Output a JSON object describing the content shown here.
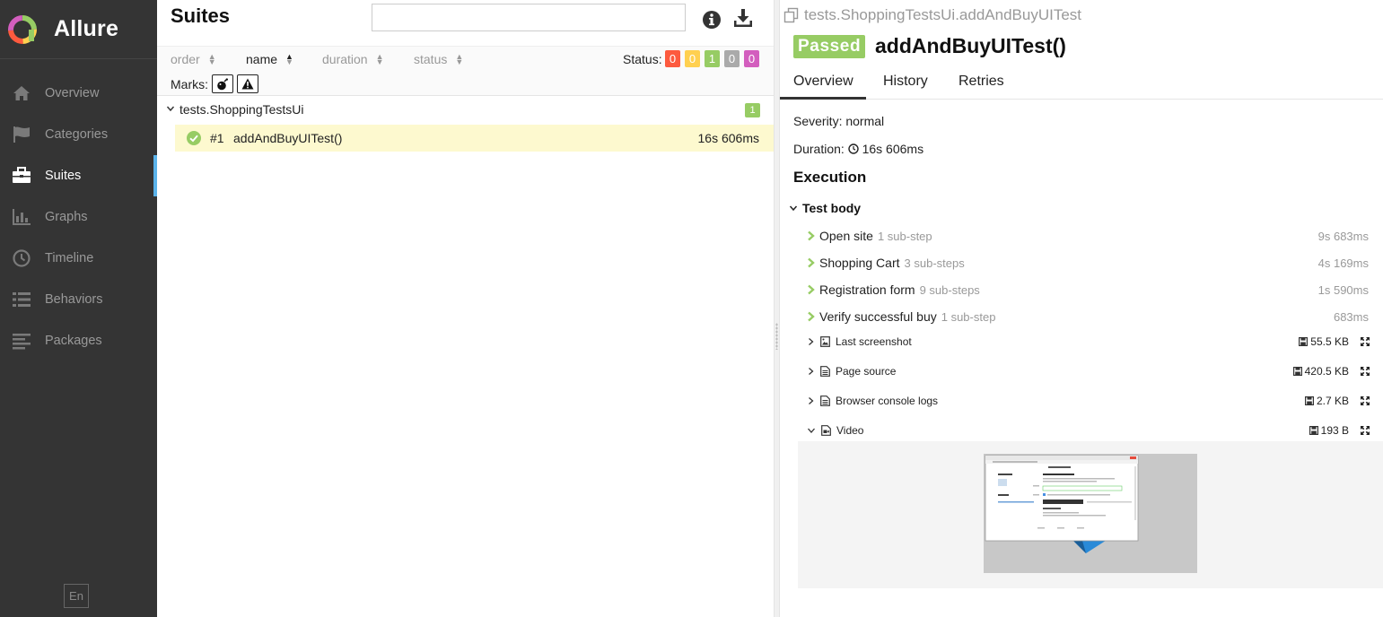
{
  "app": {
    "name": "Allure",
    "lang": "En"
  },
  "sidebar": {
    "items": [
      {
        "label": "Overview",
        "icon": "home-icon",
        "active": false
      },
      {
        "label": "Categories",
        "icon": "flag-icon",
        "active": false
      },
      {
        "label": "Suites",
        "icon": "briefcase-icon",
        "active": true
      },
      {
        "label": "Graphs",
        "icon": "bar-chart-icon",
        "active": false
      },
      {
        "label": "Timeline",
        "icon": "clock-icon",
        "active": false
      },
      {
        "label": "Behaviors",
        "icon": "list-icon",
        "active": false
      },
      {
        "label": "Packages",
        "icon": "align-left-icon",
        "active": false
      }
    ]
  },
  "suites": {
    "title": "Suites",
    "search": {
      "value": "",
      "placeholder": ""
    },
    "sort": {
      "order": "order",
      "name": "name",
      "duration": "duration",
      "status": "status"
    },
    "status_label": "Status:",
    "status_counts": [
      {
        "value": "0",
        "color": "#fd5a3e"
      },
      {
        "value": "0",
        "color": "#ffd050"
      },
      {
        "value": "1",
        "color": "#97cc64"
      },
      {
        "value": "0",
        "color": "#aaaaaa"
      },
      {
        "value": "0",
        "color": "#d35ebe"
      }
    ],
    "marks_label": "Marks:",
    "group": {
      "name": "tests.ShoppingTestsUi",
      "count": "1"
    },
    "test": {
      "num": "#1",
      "name": "addAndBuyUITest()",
      "duration": "16s 606ms"
    }
  },
  "detail": {
    "breadcrumb": "tests.ShoppingTestsUi.addAndBuyUITest",
    "status": "Passed",
    "title": "addAndBuyUITest()",
    "tabs": [
      "Overview",
      "History",
      "Retries"
    ],
    "severity_label": "Severity:",
    "severity_value": "normal",
    "duration_label": "Duration:",
    "duration_value": "16s 606ms",
    "execution_title": "Execution",
    "test_body_label": "Test body",
    "steps": [
      {
        "name": "Open site",
        "sub": "1 sub-step",
        "duration": "9s 683ms"
      },
      {
        "name": "Shopping Cart",
        "sub": "3 sub-steps",
        "duration": "4s 169ms"
      },
      {
        "name": "Registration form",
        "sub": "9 sub-steps",
        "duration": "1s 590ms"
      },
      {
        "name": "Verify successful buy",
        "sub": "1 sub-step",
        "duration": "683ms"
      }
    ],
    "attachments": [
      {
        "name": "Last screenshot",
        "size": "55.5 KB",
        "icon": "image-file-icon",
        "expanded": false
      },
      {
        "name": "Page source",
        "size": "420.5 KB",
        "icon": "text-file-icon",
        "expanded": false
      },
      {
        "name": "Browser console logs",
        "size": "2.7 KB",
        "icon": "text-file-icon",
        "expanded": false
      },
      {
        "name": "Video",
        "size": "193 B",
        "icon": "video-file-icon",
        "expanded": true
      }
    ]
  },
  "colors": {
    "sidebar_bg": "#343434",
    "accent": "#5bb3ea",
    "passed": "#97cc64",
    "selected_row": "#fdf9cf"
  }
}
